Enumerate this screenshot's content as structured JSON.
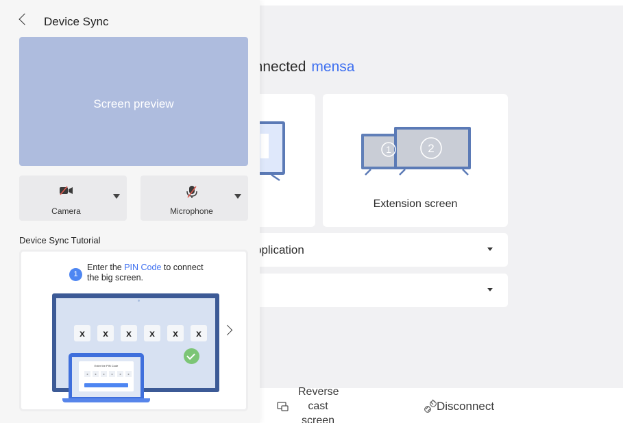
{
  "main": {
    "connection": {
      "status_text": "onnected",
      "device_name": "mensa"
    },
    "mode_cards": [
      {
        "label": ""
      },
      {
        "label": "Extension screen",
        "numbers": [
          "1",
          "2"
        ]
      }
    ],
    "select_rows": [
      {
        "value": "pplication"
      },
      {
        "value": ""
      }
    ],
    "bottom_bar": {
      "reverse_cast_label": [
        "Reverse",
        "cast",
        "screen"
      ],
      "disconnect_label": "Disconnect"
    },
    "colors": {
      "accent": "#3d6ff0",
      "background": "#f1f1f3"
    }
  },
  "panel": {
    "title": "Device Sync",
    "preview_text": "Screen preview",
    "camera_label": "Camera",
    "microphone_label": "Microphone",
    "tutorial": {
      "title": "Device Sync Tutorial",
      "step_number": "1",
      "step_text_prefix": "Enter the ",
      "step_text_highlight": "PIN Code",
      "step_text_suffix": " to connect the big screen.",
      "pin_boxes": [
        "x",
        "x",
        "x",
        "x",
        "x",
        "x"
      ],
      "mini_dialog_title": "Enter the PIN Code",
      "mini_pin_boxes": [
        "x",
        "x",
        "x",
        "x",
        "x",
        "x"
      ]
    },
    "colors": {
      "preview_bg": "#aebcde",
      "tv_frame": "#3c5a96",
      "laptop": "#3f6fdc",
      "check": "#7cc576"
    }
  }
}
